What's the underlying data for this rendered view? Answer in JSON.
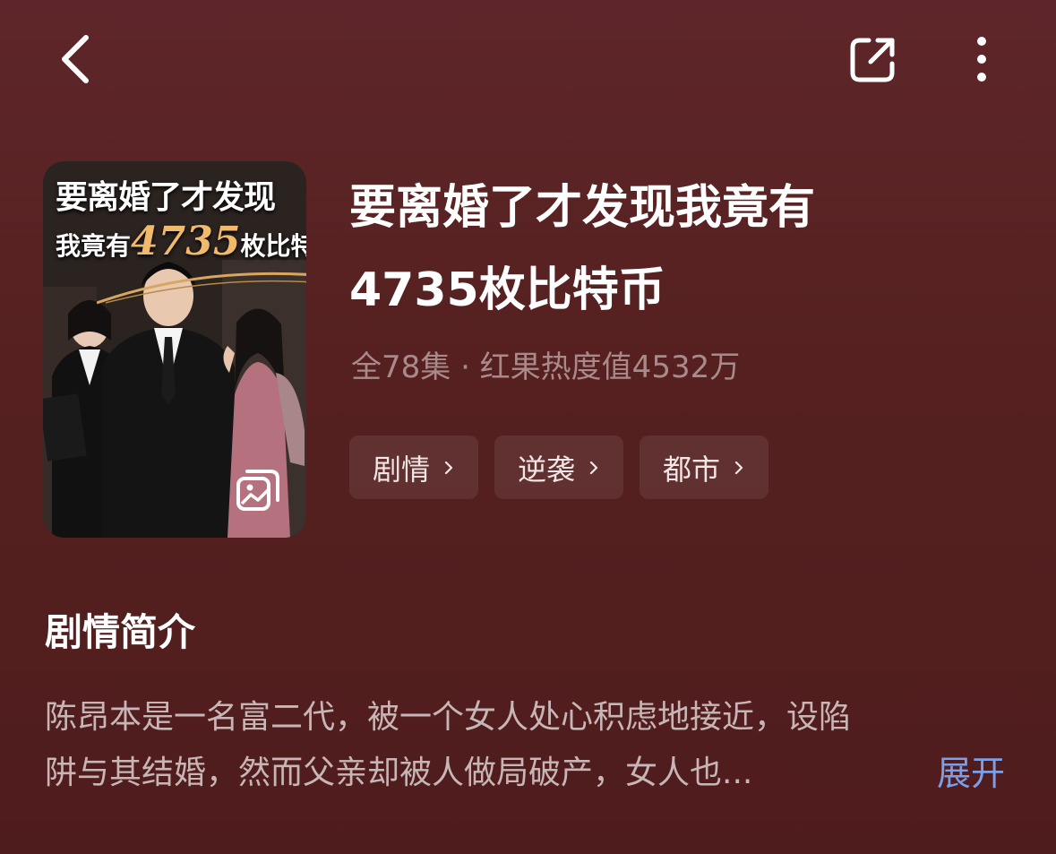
{
  "colors": {
    "background": "#55201f",
    "accent_link": "#7d9ee9",
    "meta_text": "#a98a8b",
    "cover_number": "#f1b96a"
  },
  "header": {
    "back_icon": "chevron-left-icon",
    "share_icon": "share-icon",
    "more_icon": "more-vertical-icon"
  },
  "cover": {
    "title_line1": "要离婚了才发现",
    "title_line2_prefix": "我竟有",
    "title_line2_number": "4735",
    "title_line2_suffix": "枚比特币",
    "gallery_icon": "image-gallery-icon"
  },
  "drama": {
    "title_line1": "要离婚了才发现我竟有",
    "title_line2": "4735枚比特币",
    "meta": "全78集 · 红果热度值4532万",
    "tags": [
      {
        "label": "剧情"
      },
      {
        "label": "逆袭"
      },
      {
        "label": "都市"
      }
    ]
  },
  "synopsis": {
    "heading": "剧情简介",
    "line1": "陈昂本是一名富二代，被一个女人处心积虑地接近，设陷",
    "line2": "阱与其结婚，然而父亲却被人做局破产，女人也...",
    "expand_label": "展开"
  }
}
